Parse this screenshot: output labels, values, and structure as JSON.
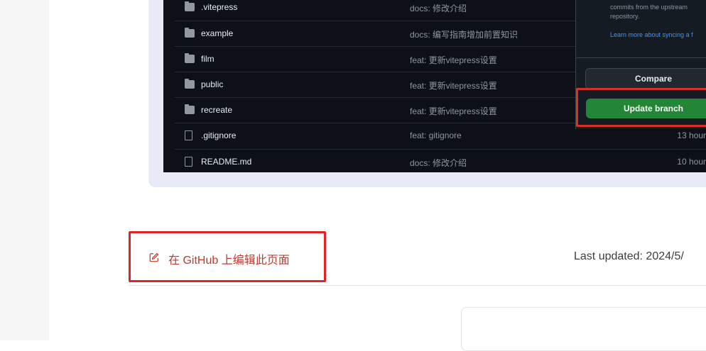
{
  "github": {
    "files": [
      {
        "name": ".vitepress",
        "message": "docs: 修改介绍",
        "time": "",
        "icon": "folder-icon"
      },
      {
        "name": "example",
        "message": "docs: 编写指南增加前置知识",
        "time": "",
        "icon": "folder-icon"
      },
      {
        "name": "film",
        "message": "feat: 更新vitepress设置",
        "time": "",
        "icon": "folder-icon"
      },
      {
        "name": "public",
        "message": "feat: 更新vitepress设置",
        "time": "",
        "icon": "folder-icon"
      },
      {
        "name": "recreate",
        "message": "feat: 更新vitepress设置",
        "time": "",
        "icon": "folder-icon"
      },
      {
        "name": ".gitignore",
        "message": "feat: gitignore",
        "time": "13 hour",
        "icon": "file-icon"
      },
      {
        "name": "README.md",
        "message": "docs: 修改介绍",
        "time": "10 hour",
        "icon": "file-icon"
      }
    ],
    "popup": {
      "text": "commits from the upstream repository.",
      "link": "Learn more about syncing a f",
      "compare_label": "Compare",
      "update_label": "Update branch"
    }
  },
  "footer": {
    "edit_link": "在 GitHub 上编辑此页面",
    "last_updated": "Last updated: 2024/5/"
  },
  "colors": {
    "accent": "#c0392b",
    "highlight_border": "#e02424",
    "update_button": "#238636"
  }
}
